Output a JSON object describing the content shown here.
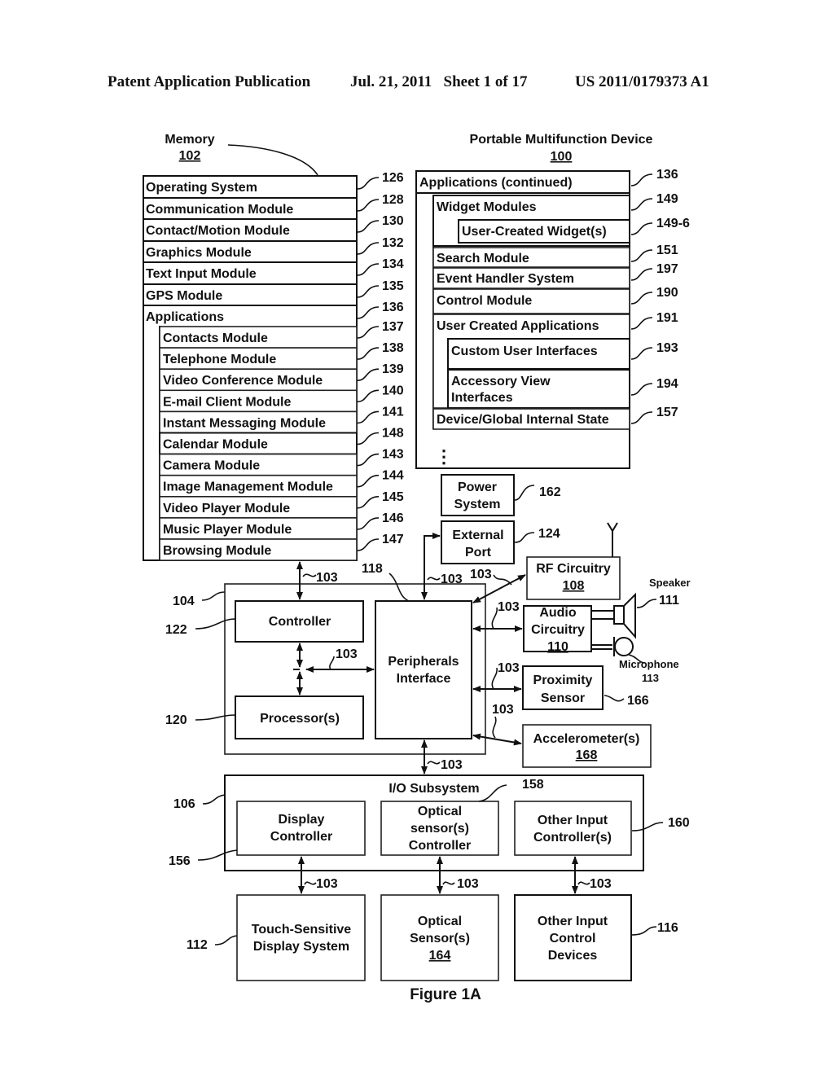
{
  "header": {
    "publication": "Patent Application Publication",
    "date_sheet": "Jul. 21, 2011   Sheet 1 of 17",
    "number": "US 2011/0179373 A1"
  },
  "memory": {
    "title": "Memory",
    "ref": "102",
    "rows": [
      {
        "label": "Operating System",
        "ref": "126"
      },
      {
        "label": "Communication Module",
        "ref": "128"
      },
      {
        "label": "Contact/Motion Module",
        "ref": "130"
      },
      {
        "label": "Graphics Module",
        "ref": "132"
      },
      {
        "label": "Text Input Module",
        "ref": "134"
      },
      {
        "label": "GPS Module",
        "ref": "135"
      },
      {
        "label": "Applications",
        "ref": "136"
      }
    ],
    "apps": [
      {
        "label": "Contacts Module",
        "ref": "137"
      },
      {
        "label": "Telephone Module",
        "ref": "138"
      },
      {
        "label": "Video Conference Module",
        "ref": "139"
      },
      {
        "label": "E-mail Client Module",
        "ref": "140"
      },
      {
        "label": "Instant Messaging Module",
        "ref": "141"
      },
      {
        "label": "Calendar Module",
        "ref": "148"
      },
      {
        "label": "Camera Module",
        "ref": "143"
      },
      {
        "label": "Image Management Module",
        "ref": "144"
      },
      {
        "label": "Video Player Module",
        "ref": "145"
      },
      {
        "label": "Music Player Module",
        "ref": "146"
      },
      {
        "label": "Browsing Module",
        "ref": "147"
      }
    ]
  },
  "device": {
    "title": "Portable Multifunction Device",
    "ref": "100",
    "apps_continued": {
      "label": "Applications (continued)",
      "ref": "136"
    },
    "widget_modules": {
      "label": "Widget Modules",
      "ref": "149"
    },
    "user_widgets": {
      "label": "User-Created Widget(s)",
      "ref": "149-6"
    },
    "search": {
      "label": "Search Module",
      "ref": "151"
    },
    "event_handler": {
      "label": "Event Handler System",
      "ref": "197"
    },
    "control": {
      "label": "Control Module",
      "ref": "190"
    },
    "user_apps": {
      "label": "User Created Applications",
      "ref": "191"
    },
    "custom_ui": {
      "label": "Custom User Interfaces",
      "ref": "193"
    },
    "accessory_line1": "Accessory View",
    "accessory_line2": "Interfaces",
    "accessory_ref": "194",
    "device_state": {
      "label": "Device/Global Internal State",
      "ref": "157"
    },
    "ellipsis": "⋮"
  },
  "components": {
    "power_line1": "Power",
    "power_line2": "System",
    "power_ref": "162",
    "ext_line1": "External",
    "ext_line2": "Port",
    "ext_ref": "124",
    "rf_label": "RF Circuitry",
    "rf_ref": "108",
    "audio_line1": "Audio",
    "audio_line2": "Circuitry",
    "audio_ref": "110",
    "speaker_label": "Speaker",
    "speaker_ref": "111",
    "mic_label": "Microphone",
    "mic_ref": "113",
    "prox_line1": "Proximity",
    "prox_line2": "Sensor",
    "prox_ref": "166",
    "accel_label": "Accelerometer(s)",
    "accel_ref": "168",
    "controller": "Controller",
    "controller_ref": "122",
    "processor": "Processor(s)",
    "processor_ref": "120",
    "periph_line1": "Peripherals",
    "periph_line2": "Interface",
    "periph_ref": "118",
    "chip_ref": "104",
    "bus_ref": "103",
    "io_title": "I/O Subsystem",
    "io_ref": "106",
    "disp_ctrl_line1": "Display",
    "disp_ctrl_line2": "Controller",
    "disp_ctrl_ref": "156",
    "opt_ctrl_line1": "Optical",
    "opt_ctrl_line2": "sensor(s)",
    "opt_ctrl_line3": "Controller",
    "opt_ctrl_ref": "158",
    "other_ctrl_line1": "Other Input",
    "other_ctrl_line2": "Controller(s)",
    "other_ctrl_ref": "160",
    "touch_line1": "Touch-Sensitive",
    "touch_line2": "Display System",
    "touch_ref": "112",
    "opt_sens_line1": "Optical",
    "opt_sens_line2": "Sensor(s)",
    "opt_sens_ref": "164",
    "other_dev_line1": "Other Input",
    "other_dev_line2": "Control",
    "other_dev_line3": "Devices",
    "other_dev_ref": "116"
  },
  "figure_caption": "Figure 1A"
}
